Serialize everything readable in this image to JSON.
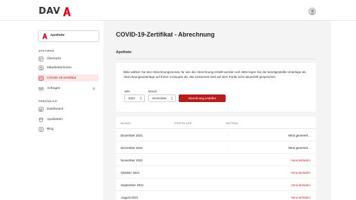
{
  "header": {
    "logo_text": "DAV",
    "brand_color": "#e2001a"
  },
  "sidebar": {
    "pharmacy": {
      "name": "Apotheke"
    },
    "section_apotheke": "APOTHEKE",
    "items_apotheke": [
      {
        "label": "Übersicht",
        "icon": "grid-icon"
      },
      {
        "label": "Mitarbeiter/innen",
        "icon": "users-icon"
      },
      {
        "label": "COVID-19-Zertifikat",
        "icon": "certificate-icon",
        "active": true
      },
      {
        "label": "Anfragen",
        "icon": "inbox-icon",
        "badge": "0"
      }
    ],
    "section_persoenlich": "PERSÖNLICH",
    "items_persoenlich": [
      {
        "label": "Dashboard",
        "icon": "dashboard-icon"
      },
      {
        "label": "Apotheken",
        "icon": "store-icon"
      },
      {
        "label": "Blog",
        "icon": "blog-icon"
      }
    ]
  },
  "main": {
    "title": "COVID-19-Zertifikat - Abrechnung",
    "subtitle": "Apotheke",
    "info": {
      "text": "Bitte wählen Sie den Abrechnungsmonat, für den die Abrechnung erstellt werden soll. Bitte legen Sie die bereitgestellte Unterlage als Abrechnungsunterlage auf Ihrem Computer ab, das Dokument wird auf dem Portal nicht dauerhaft gespeichert.",
      "year_label": "Jahr",
      "year_value": "2021",
      "month_label": "Monat",
      "month_value": "Dezember",
      "button_label": "Abrechnung erstellen"
    },
    "table": {
      "columns": [
        "MONAT",
        "ERSTELLER",
        "BETRAG"
      ],
      "rows": [
        {
          "month": "Dezember 2021",
          "creator": "",
          "amount": "-",
          "status": "Wird generiert...",
          "status_type": "gen"
        },
        {
          "month": "Dezember 2021",
          "creator": "",
          "amount": "-",
          "status": "Wird generiert...",
          "status_type": "gen"
        },
        {
          "month": "November 2021",
          "creator": "",
          "amount": "",
          "status": "Herunterladen",
          "status_type": "dl"
        },
        {
          "month": "Oktober 2021",
          "creator": "",
          "amount": "",
          "status": "Herunterladen",
          "status_type": "dl"
        },
        {
          "month": "September 2021",
          "creator": "",
          "amount": "",
          "status": "Herunterladen",
          "status_type": "dl"
        },
        {
          "month": "August 2021",
          "creator": "",
          "amount": "",
          "status": "Herunterladen",
          "status_type": "dl"
        }
      ]
    }
  }
}
